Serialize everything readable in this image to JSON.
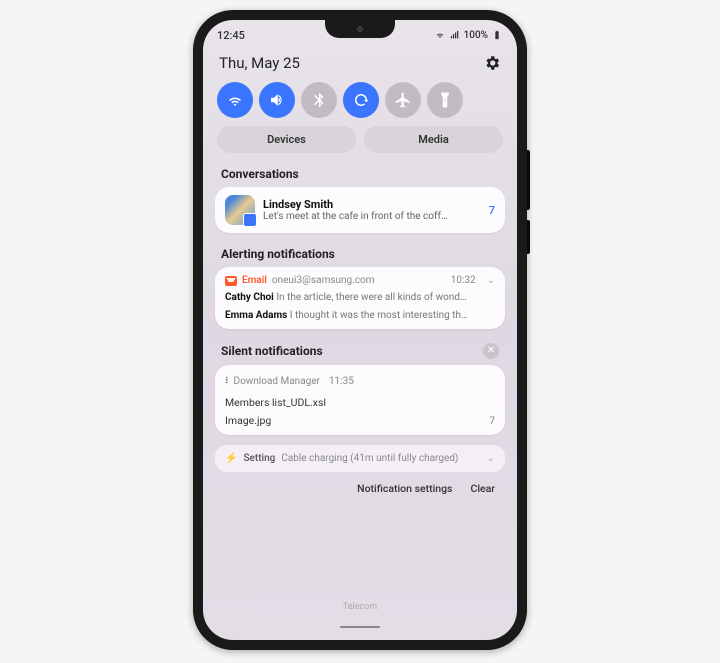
{
  "status": {
    "time": "12:45",
    "battery": "100%"
  },
  "header": {
    "date": "Thu, May 25"
  },
  "quick_buttons": {
    "devices": "Devices",
    "media": "Media"
  },
  "sections": {
    "conversations": "Conversations",
    "alerting": "Alerting notifications",
    "silent": "Silent notifications"
  },
  "conversation": {
    "name": "Lindsey Smith",
    "message": "Let's meet at the cafe in front of the coff…",
    "count": "7"
  },
  "alerting_card": {
    "app": "Email",
    "account": "oneui3@samsung.com",
    "time": "10:32",
    "items": [
      {
        "sender": "Cathy Choi",
        "body": "In the article, there were all kinds of wond…"
      },
      {
        "sender": "Emma Adams",
        "body": "I thought it was the most interesting th…"
      }
    ]
  },
  "silent_card": {
    "app": "Download Manager",
    "time": "11:35",
    "files": [
      {
        "name": "Members list_UDL.xsl",
        "count": ""
      },
      {
        "name": "Image.jpg",
        "count": "7"
      }
    ]
  },
  "charging": {
    "app": "Setting",
    "text": "Cable charging (41m until fully charged)"
  },
  "footer": {
    "settings": "Notification settings",
    "clear": "Clear"
  },
  "carrier": "Telecom"
}
